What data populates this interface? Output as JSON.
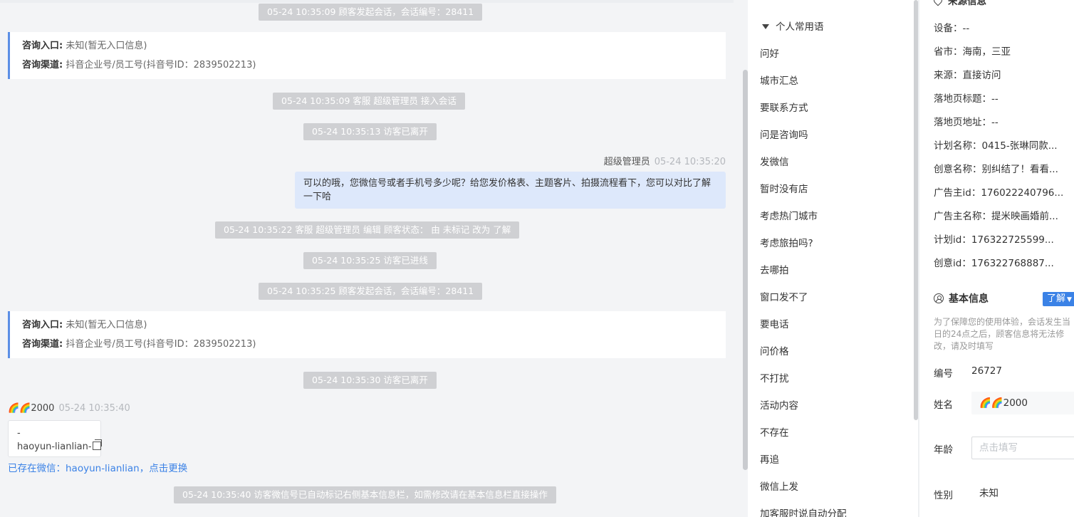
{
  "chat": {
    "system_messages": [
      "05-24 10:35:09 顾客发起会话，会话编号：28411",
      "05-24 10:35:09 客服 超级管理员 接入会话",
      "05-24 10:35:13 访客已离开",
      "05-24 10:35:22 客服 超级管理员 编辑 顾客状态： 由 未标记 改为 了解",
      "05-24 10:35:25 访客已进线",
      "05-24 10:35:25 顾客发起会话，会话编号：28411",
      "05-24 10:35:30 访客已离开",
      "05-24 10:35:40 访客微信号已自动标记右侧基本信息栏，如需修改请在基本信息栏直接操作"
    ],
    "info_cards": [
      {
        "entry_label": "咨询入口:",
        "entry_value": "未知(暂无入口信息)",
        "channel_label": "咨询渠道:",
        "channel_value": "抖音企业号/员工号(抖音号ID：2839502213)"
      },
      {
        "entry_label": "咨询入口:",
        "entry_value": "未知(暂无入口信息)",
        "channel_label": "咨询渠道:",
        "channel_value": "抖音企业号/员工号(抖音号ID：2839502213)"
      }
    ],
    "agent_message": {
      "name": "超级管理员",
      "time": "05-24 10:35:20",
      "text": "可以的哦，您微信号或者手机号多少呢？给您发价格表、主题客片、拍摄流程看下，您可以对比了解一下哈"
    },
    "visitor_message": {
      "name": "🌈🌈2000",
      "time": "05-24 10:35:40",
      "line1": "-",
      "line2": "haoyun-lianlian-"
    },
    "wechat_notice": "已存在微信：haoyun-lianlian，点击更换"
  },
  "phrases": {
    "header": "个人常用语",
    "items": [
      "问好",
      "城市汇总",
      "要联系方式",
      "问是咨询吗",
      "发微信",
      "暂时没有店",
      "考虑热门城市",
      "考虑旅拍吗?",
      "去哪拍",
      "窗口发不了",
      "要电话",
      "问价格",
      "不打扰",
      "活动内容",
      "不存在",
      "再追",
      "微信上发",
      "加客服时说自动分配"
    ]
  },
  "source_info": {
    "title": "来源信息",
    "rows": [
      "设备：--",
      "省市：海南，三亚",
      "来源：直接访问",
      "落地页标题：--",
      "落地页地址：--",
      "计划名称：0415-张琳同款...",
      "创意名称：别纠结了！看看...",
      "广告主id：176022240796...",
      "广告主名称：提米映画婚前...",
      "计划id：176322725599...",
      "创意id：176322768887..."
    ]
  },
  "basic_info": {
    "title": "基本信息",
    "status_badge": "了解",
    "note": "为了保障您的使用体验，会话发生当日的24点之后，顾客信息将无法修改，请及时填写",
    "id_label": "编号",
    "id_value": "26727",
    "name_label": "姓名",
    "name_value": "🌈🌈2000",
    "age_label": "年龄",
    "age_placeholder": "点击填写",
    "gender_label": "性别",
    "gender_value": "未知"
  }
}
